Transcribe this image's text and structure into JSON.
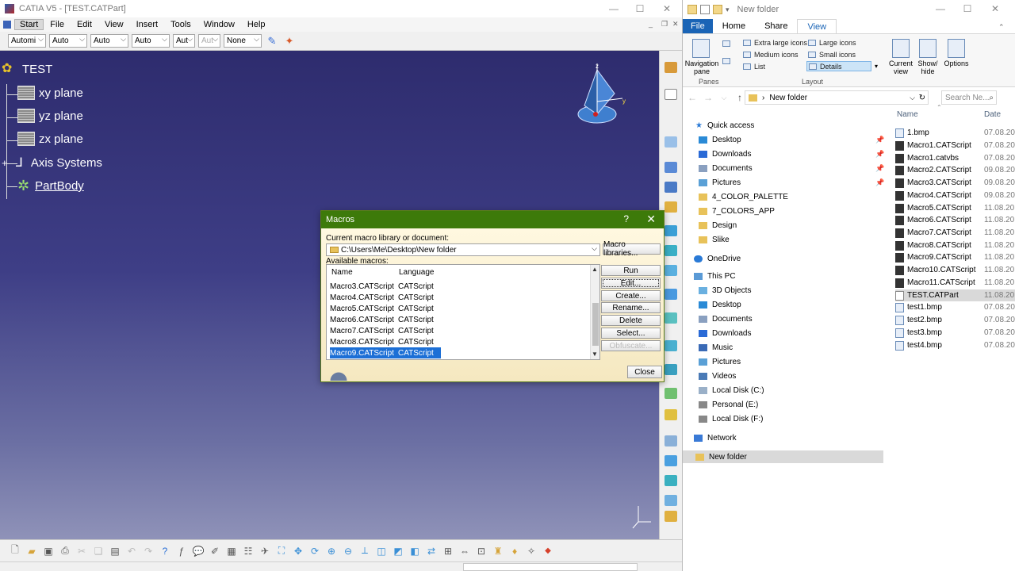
{
  "catia": {
    "title": "CATIA V5 - [TEST.CATPart]",
    "menu": [
      "Start",
      "File",
      "Edit",
      "View",
      "Insert",
      "Tools",
      "Window",
      "Help"
    ],
    "toolbar_selects": [
      "Automi",
      "Auto",
      "Auto",
      "Auto",
      "Aut",
      "Aut",
      "None"
    ],
    "tree": {
      "root": "TEST",
      "items": [
        "xy plane",
        "yz plane",
        "zx plane",
        "Axis Systems",
        "PartBody"
      ]
    }
  },
  "macros": {
    "title": "Macros",
    "help": "?",
    "library_label": "Current macro library or document:",
    "library_path": "C:\\Users\\Me\\Desktop\\New folder",
    "available_label": "Available macros:",
    "columns": [
      "Name",
      "Language"
    ],
    "rows": [
      {
        "name": "Macro3.CATScript",
        "lang": "CATScript"
      },
      {
        "name": "Macro4.CATScript",
        "lang": "CATScript"
      },
      {
        "name": "Macro5.CATScript",
        "lang": "CATScript"
      },
      {
        "name": "Macro6.CATScript",
        "lang": "CATScript"
      },
      {
        "name": "Macro7.CATScript",
        "lang": "CATScript"
      },
      {
        "name": "Macro8.CATScript",
        "lang": "CATScript"
      },
      {
        "name": "Macro9.CATScript",
        "lang": "CATScript"
      }
    ],
    "buttons": {
      "libraries": "Macro libraries...",
      "run": "Run",
      "edit": "Edit...",
      "create": "Create...",
      "rename": "Rename...",
      "delete": "Delete",
      "select": "Select...",
      "obfuscate": "Obfuscate...",
      "close": "Close"
    }
  },
  "explorer": {
    "title": "New folder",
    "tabs": [
      "File",
      "Home",
      "Share",
      "View"
    ],
    "ribbon": {
      "nav_pane": "Navigation pane",
      "layout_items": [
        "Extra large icons",
        "Large icons",
        "Medium icons",
        "Small icons",
        "List",
        "Details"
      ],
      "current_view": "Current view",
      "show_hide": "Show/ hide",
      "options": "Options",
      "groups": [
        "Panes",
        "Layout"
      ]
    },
    "address": "New folder",
    "search_placeholder": "Search Ne...",
    "nav": {
      "quick_access": "Quick access",
      "quick_items": [
        "Desktop",
        "Downloads",
        "Documents",
        "Pictures",
        "4_COLOR_PALETTE",
        "7_COLORS_APP",
        "Design",
        "Slike"
      ],
      "onedrive": "OneDrive",
      "this_pc": "This PC",
      "pc_items": [
        "3D Objects",
        "Desktop",
        "Documents",
        "Downloads",
        "Music",
        "Pictures",
        "Videos",
        "Local Disk (C:)",
        "Personal (E:)",
        "Local Disk (F:)"
      ],
      "network": "Network",
      "new_folder": "New folder"
    },
    "columns": {
      "name": "Name",
      "date": "Date"
    },
    "files": [
      {
        "name": "1.bmp",
        "date": "07.08.20"
      },
      {
        "name": "Macro1.CATScript",
        "date": "07.08.20"
      },
      {
        "name": "Macro1.catvbs",
        "date": "07.08.20"
      },
      {
        "name": "Macro2.CATScript",
        "date": "09.08.20"
      },
      {
        "name": "Macro3.CATScript",
        "date": "09.08.20"
      },
      {
        "name": "Macro4.CATScript",
        "date": "09.08.20"
      },
      {
        "name": "Macro5.CATScript",
        "date": "11.08.20"
      },
      {
        "name": "Macro6.CATScript",
        "date": "11.08.20"
      },
      {
        "name": "Macro7.CATScript",
        "date": "11.08.20"
      },
      {
        "name": "Macro8.CATScript",
        "date": "11.08.20"
      },
      {
        "name": "Macro9.CATScript",
        "date": "11.08.20"
      },
      {
        "name": "Macro10.CATScript",
        "date": "11.08.20"
      },
      {
        "name": "Macro11.CATScript",
        "date": "11.08.20"
      },
      {
        "name": "TEST.CATPart",
        "date": "11.08.20"
      },
      {
        "name": "test1.bmp",
        "date": "07.08.20"
      },
      {
        "name": "test2.bmp",
        "date": "07.08.20"
      },
      {
        "name": "test3.bmp",
        "date": "07.08.20"
      },
      {
        "name": "test4.bmp",
        "date": "07.08.20"
      }
    ]
  }
}
